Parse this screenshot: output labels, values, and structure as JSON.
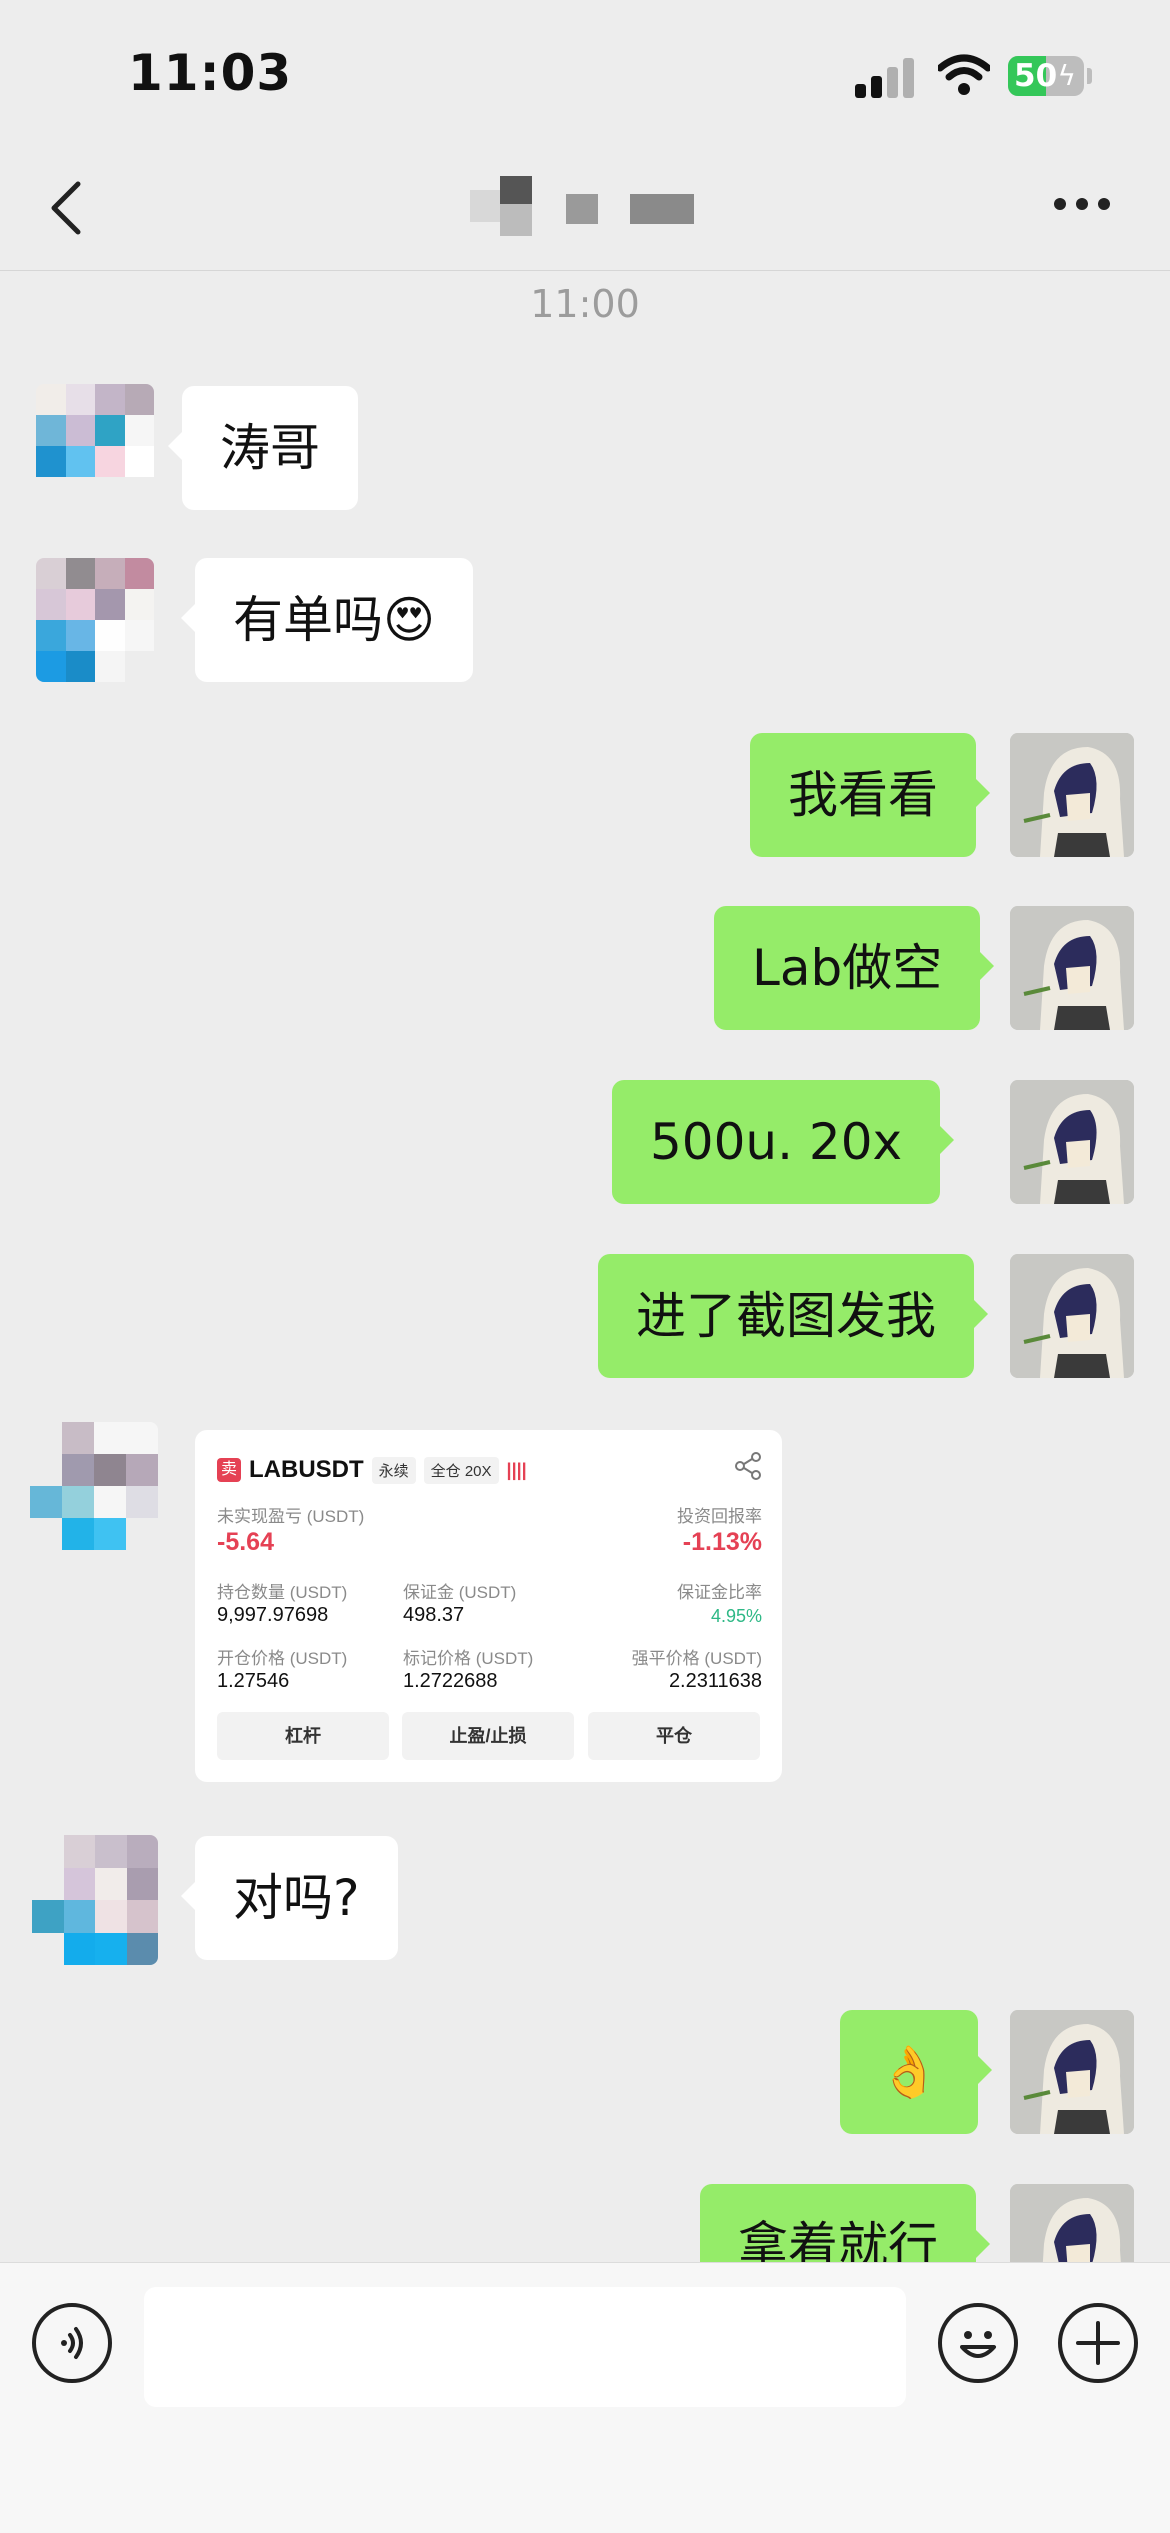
{
  "status_bar": {
    "time": "11:03",
    "battery": "50",
    "battery_fraction": 0.5
  },
  "nav": {
    "title": "",
    "back_icon": "chevron-left-icon",
    "more_icon": "ellipsis-icon"
  },
  "chat": {
    "timestamp": "11:00",
    "messages": [
      {
        "side": "in",
        "text": "涛哥"
      },
      {
        "side": "in",
        "text": "有单吗😍"
      },
      {
        "side": "out",
        "text": "我看看"
      },
      {
        "side": "out",
        "text": "Lab做空"
      },
      {
        "side": "out",
        "text": "500u.    20x"
      },
      {
        "side": "out",
        "text": "进了截图发我"
      },
      {
        "side": "in",
        "text": "对吗?"
      },
      {
        "side": "out",
        "text": "👌"
      },
      {
        "side": "out",
        "text": "拿着就行"
      }
    ]
  },
  "trade_card": {
    "side_tag": "卖",
    "symbol": "LABUSDT",
    "type": "永续",
    "margin_mode": "全仓 20X",
    "unrealized_pnl_label": "未实现盈亏 (USDT)",
    "unrealized_pnl": "-5.64",
    "roi_label": "投资回报率",
    "roi": "-1.13%",
    "position_size_label": "持仓数量 (USDT)",
    "position_size": "9,997.97698",
    "margin_label": "保证金 (USDT)",
    "margin": "498.37",
    "margin_ratio_label": "保证金比率",
    "margin_ratio": "4.95%",
    "entry_price_label": "开仓价格 (USDT)",
    "entry_price": "1.27546",
    "mark_price_label": "标记价格 (USDT)",
    "mark_price": "1.2722688",
    "liq_price_label": "强平价格 (USDT)",
    "liq_price": "2.2311638",
    "buttons": [
      "杠杆",
      "止盈/止损",
      "平仓"
    ]
  },
  "input_bar": {
    "voice_icon": "voice-icon",
    "emoji_icon": "smile-icon",
    "plus_icon": "plus-icon"
  },
  "colors": {
    "outgoing_bubble": "#95ec69",
    "incoming_bubble": "#ffffff",
    "background": "#ededed",
    "loss": "#e54154",
    "gain": "#2eb886"
  }
}
